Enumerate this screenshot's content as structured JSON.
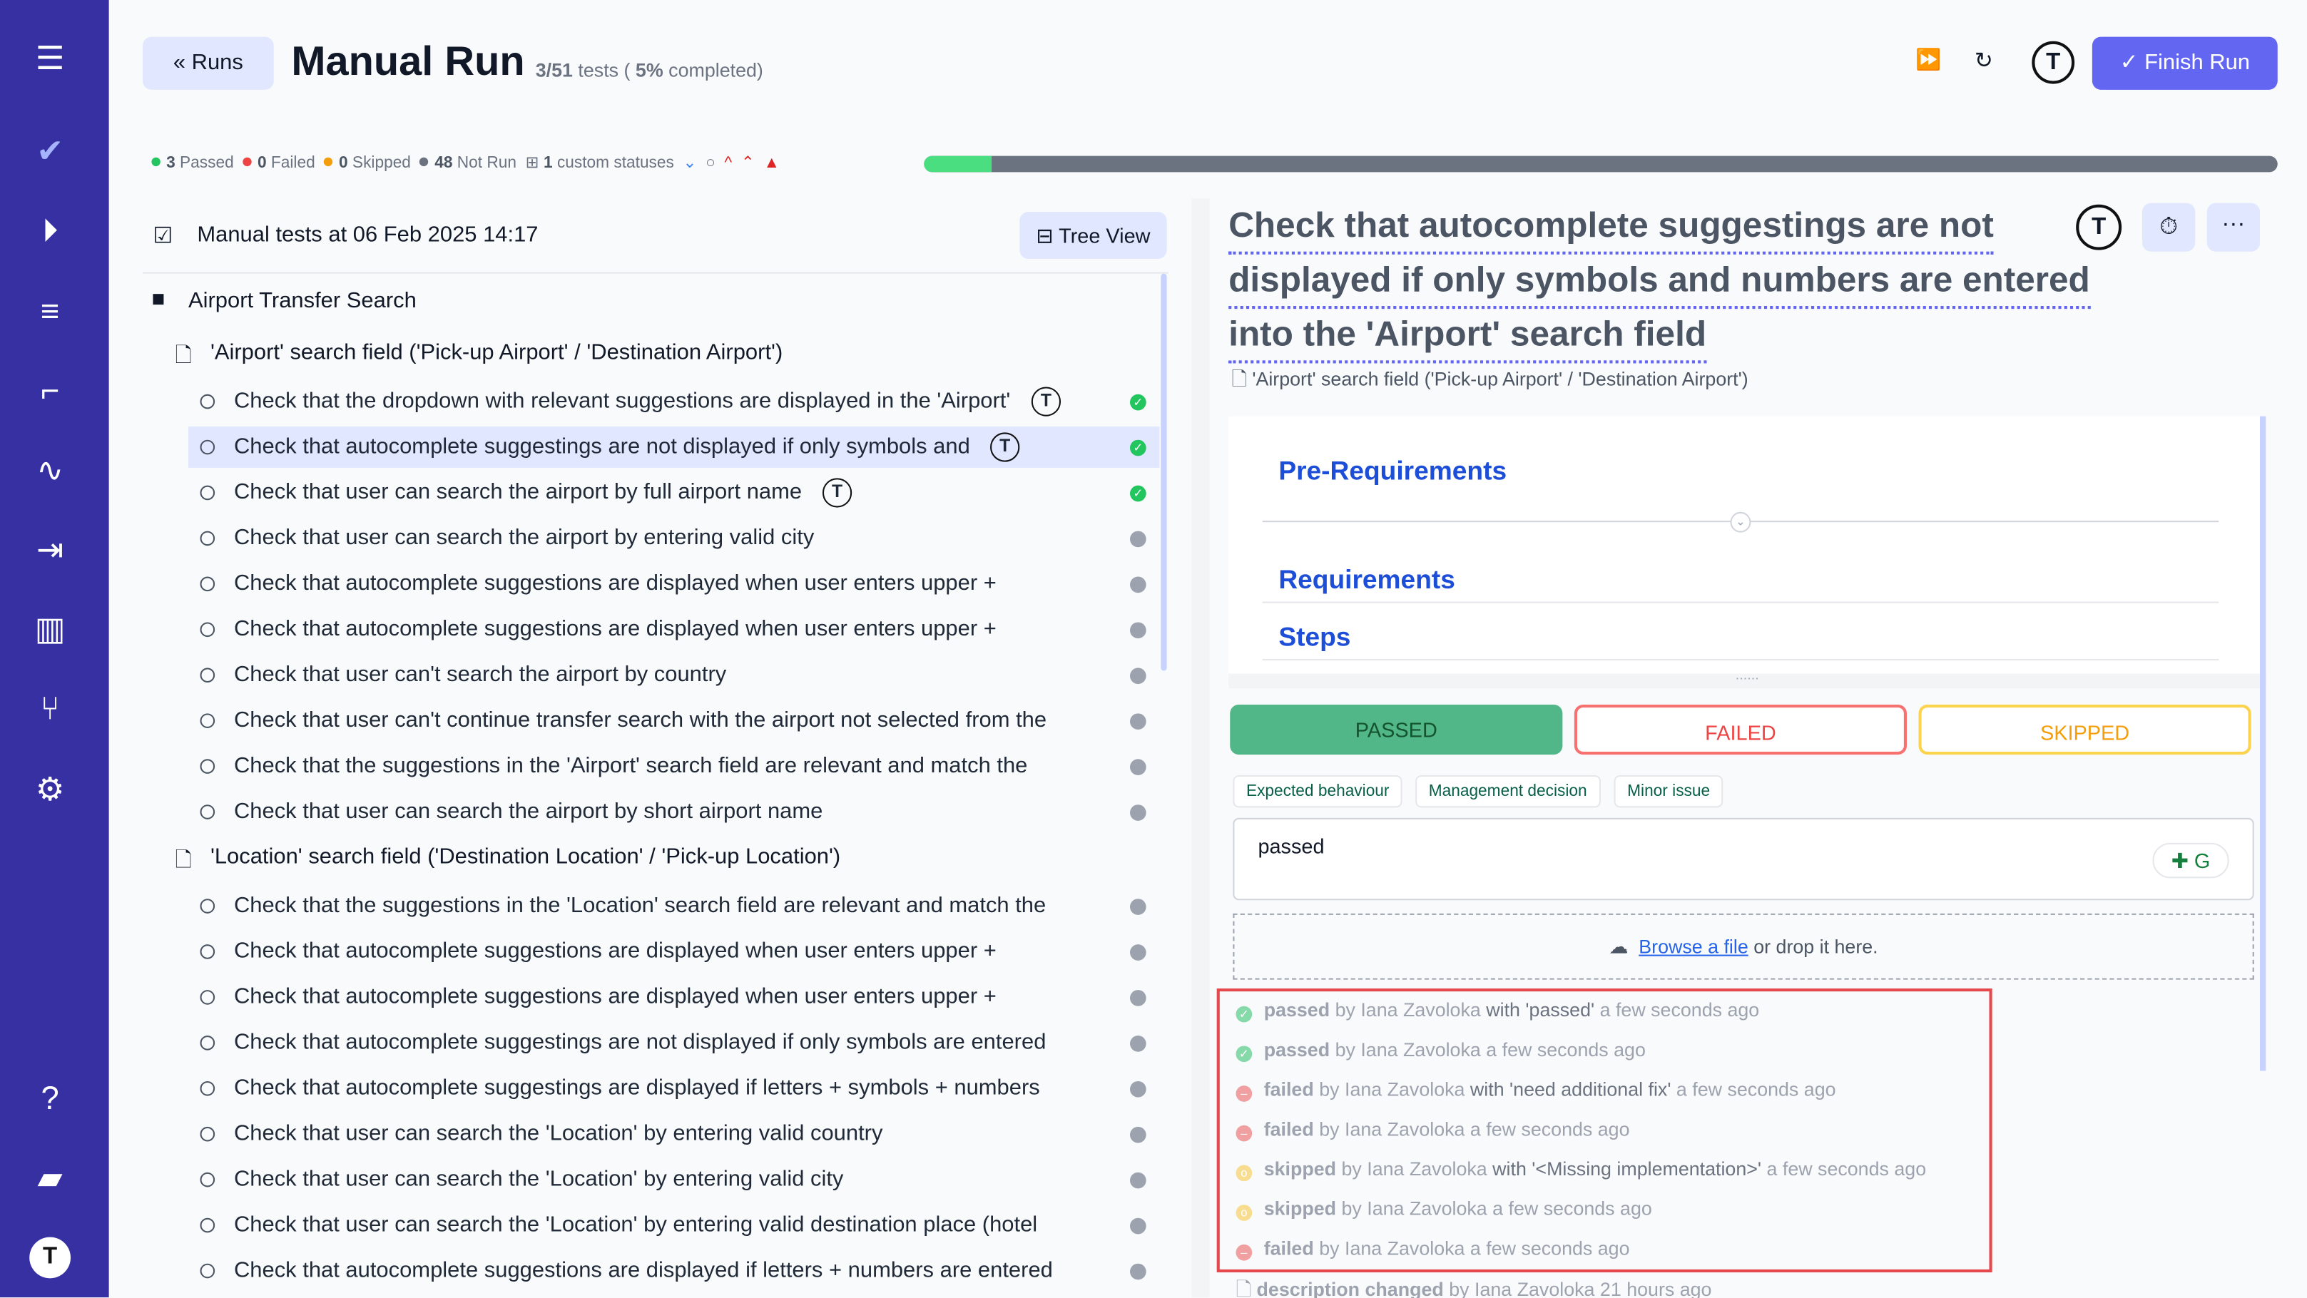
{
  "header": {
    "back_label": "Runs",
    "title": "Manual Run",
    "progress_count": "3/51",
    "progress_tests": "tests (",
    "progress_pct": "5%",
    "progress_completed": "completed)",
    "finish_label": "Finish Run"
  },
  "stats": {
    "passed": "3",
    "passed_label": "Passed",
    "failed": "0",
    "failed_label": "Failed",
    "skipped": "0",
    "skipped_label": "Skipped",
    "not_run": "48",
    "not_run_label": "Not Run",
    "custom": "1",
    "custom_label": "custom statuses",
    "progress_percent": 5,
    "colors": {
      "passed": "#22c55e",
      "failed": "#ef4444",
      "skipped": "#f59e0b",
      "not_run": "#6b7280"
    }
  },
  "left": {
    "title": "Manual tests at 06 Feb 2025 14:17",
    "tree_view": "Tree View",
    "suite": "Airport Transfer Search",
    "groups": [
      {
        "title": "'Airport' search field ('Pick-up Airport' / 'Destination Airport')",
        "items": [
          {
            "t": "Check that the dropdown with relevant suggestions are displayed in the 'Airport'",
            "s": "passed",
            "tm": true
          },
          {
            "t": "Check that autocomplete suggestings are not displayed if only symbols and",
            "s": "passed",
            "tm": true,
            "sel": true
          },
          {
            "t": "Check that user can search the airport by full airport name",
            "s": "passed",
            "tm": true
          },
          {
            "t": "Check that user can search the airport by entering valid city",
            "s": "none"
          },
          {
            "t": "Check that autocomplete suggestions are displayed when user enters upper +",
            "s": "none"
          },
          {
            "t": "Check that autocomplete suggestions are displayed when user enters upper +",
            "s": "none"
          },
          {
            "t": "Check that user can't search the airport by country",
            "s": "none"
          },
          {
            "t": "Check that user can't continue transfer search with the airport not selected from the",
            "s": "none"
          },
          {
            "t": "Check that the suggestions in the 'Airport' search field are relevant and match the",
            "s": "none"
          },
          {
            "t": "Check that user can search the airport by short airport name",
            "s": "none"
          }
        ]
      },
      {
        "title": "'Location' search field ('Destination Location' / 'Pick-up Location')",
        "items": [
          {
            "t": "Check that the suggestions in the 'Location' search field are relevant and match the",
            "s": "none"
          },
          {
            "t": "Check that autocomplete suggestions are displayed when user enters upper +",
            "s": "none"
          },
          {
            "t": "Check that autocomplete suggestions are displayed when user enters upper +",
            "s": "none"
          },
          {
            "t": "Check that autocomplete suggestings are not displayed if only symbols are entered",
            "s": "none"
          },
          {
            "t": "Check that autocomplete suggestings are displayed if letters + symbols + numbers",
            "s": "none"
          },
          {
            "t": "Check that user can search the 'Location' by entering valid country",
            "s": "none"
          },
          {
            "t": "Check that user can search the 'Location' by entering valid city",
            "s": "none"
          },
          {
            "t": "Check that user can search the 'Location' by entering valid destination place (hotel",
            "s": "none"
          },
          {
            "t": "Check that autocomplete suggestions are displayed if letters + numbers are entered",
            "s": "none"
          }
        ]
      }
    ]
  },
  "detail": {
    "title_lines": [
      "Check that autocomplete suggestings are not",
      "displayed if only symbols and numbers are entered",
      "into the 'Airport' search field"
    ],
    "suite": "'Airport' search field ('Pick-up Airport' / 'Destination Airport')",
    "pre_req": "Pre-Requirements",
    "req": "Requirements",
    "steps": "Steps",
    "passed": "PASSED",
    "failed": "FAILED",
    "skipped": "SKIPPED",
    "tags": [
      "Expected behaviour",
      "Management decision",
      "Minor issue"
    ],
    "comment": "passed",
    "browse": "Browse a file",
    "drop": "or drop it here.",
    "history": [
      {
        "s": "passed",
        "by": "by Iana Zavoloka",
        "with": "with 'passed'",
        "when": "a few seconds ago"
      },
      {
        "s": "passed",
        "by": "by Iana Zavoloka",
        "with": "",
        "when": "a few seconds ago"
      },
      {
        "s": "failed",
        "by": "by Iana Zavoloka",
        "with": "with 'need additional fix'",
        "when": "a few seconds ago"
      },
      {
        "s": "failed",
        "by": "by Iana Zavoloka",
        "with": "",
        "when": "a few seconds ago"
      },
      {
        "s": "skipped",
        "by": "by Iana Zavoloka",
        "with": "with '<Missing implementation>'",
        "when": "a few seconds ago"
      },
      {
        "s": "skipped",
        "by": "by Iana Zavoloka",
        "with": "",
        "when": "a few seconds ago"
      },
      {
        "s": "failed",
        "by": "by Iana Zavoloka",
        "with": "",
        "when": "a few seconds ago"
      }
    ],
    "last": {
      "s": "description changed",
      "by": "by Iana Zavoloka",
      "when": "21 hours ago"
    }
  }
}
